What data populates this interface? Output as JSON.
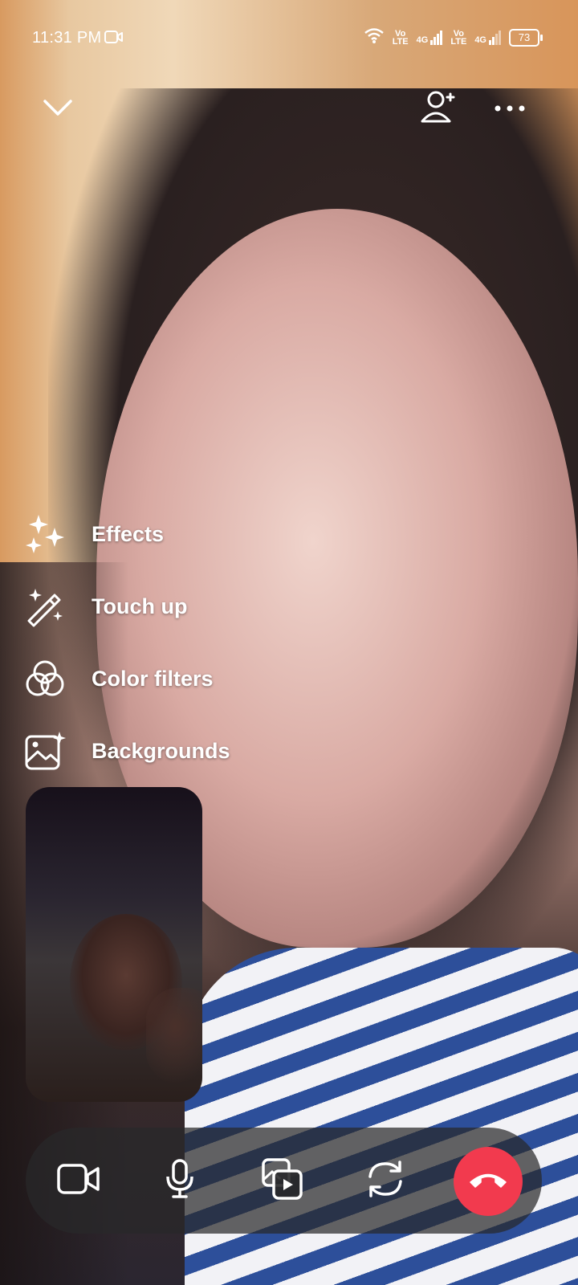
{
  "status_bar": {
    "time": "11:31 PM",
    "sim1_volte_top": "Vo",
    "sim1_volte_bottom": "LTE",
    "sim1_network": "4G",
    "sim2_volte_top": "Vo",
    "sim2_volte_bottom": "LTE",
    "sim2_network": "4G",
    "battery": "73",
    "icons": [
      "video-recording-icon",
      "wifi-icon",
      "signal-icon",
      "battery-icon"
    ]
  },
  "top_bar": {
    "icons": [
      "chevron-down-icon",
      "add-person-icon",
      "more-options-icon"
    ]
  },
  "effects_menu": {
    "items": [
      {
        "label": "Effects",
        "icon": "sparkles-icon"
      },
      {
        "label": "Touch up",
        "icon": "magic-wand-icon"
      },
      {
        "label": "Color filters",
        "icon": "color-filters-icon"
      },
      {
        "label": "Backgrounds",
        "icon": "background-image-icon"
      }
    ]
  },
  "call_controls": {
    "icons": [
      "camera-icon",
      "microphone-icon",
      "media-share-icon",
      "flip-camera-icon",
      "end-call-icon"
    ],
    "end_call_color": "#f23a4e"
  }
}
